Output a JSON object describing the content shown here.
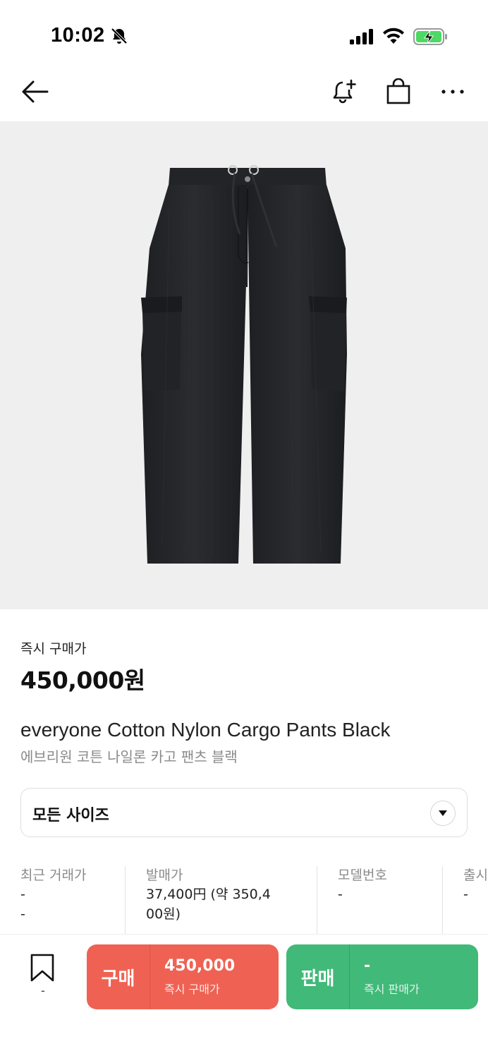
{
  "status_bar": {
    "time": "10:02",
    "icons": [
      "bell-off-icon",
      "signal-icon",
      "wifi-icon",
      "battery-charging-icon"
    ]
  },
  "nav": {
    "icons": [
      "back-arrow-icon",
      "bell-plus-icon",
      "shopping-bag-icon",
      "more-icon"
    ]
  },
  "product": {
    "instant_buy_label": "즉시 구매가",
    "price": "450,000원",
    "name_en": "everyone Cotton Nylon Cargo Pants Black",
    "name_ko": "에브리원 코튼 나일론 카고 팬츠 블랙"
  },
  "size_select": {
    "label": "모든 사이즈"
  },
  "stats": [
    {
      "title": "최근 거래가",
      "lines": [
        "-",
        "-"
      ]
    },
    {
      "title": "발매가",
      "lines": [
        "37,400円 (약 350,4",
        "00원)"
      ]
    },
    {
      "title": "모델번호",
      "lines": [
        "-"
      ]
    },
    {
      "title": "출시",
      "lines": [
        "-"
      ]
    }
  ],
  "bottom": {
    "bookmark_count": "-",
    "buy": {
      "label": "구매",
      "price": "450,000",
      "sub": "즉시 구매가"
    },
    "sell": {
      "label": "판매",
      "price": "-",
      "sub": "즉시 판매가"
    }
  },
  "colors": {
    "buy": "#ef6253",
    "sell": "#41b979",
    "image_bg": "#efefef",
    "battery": "#4cd964"
  }
}
